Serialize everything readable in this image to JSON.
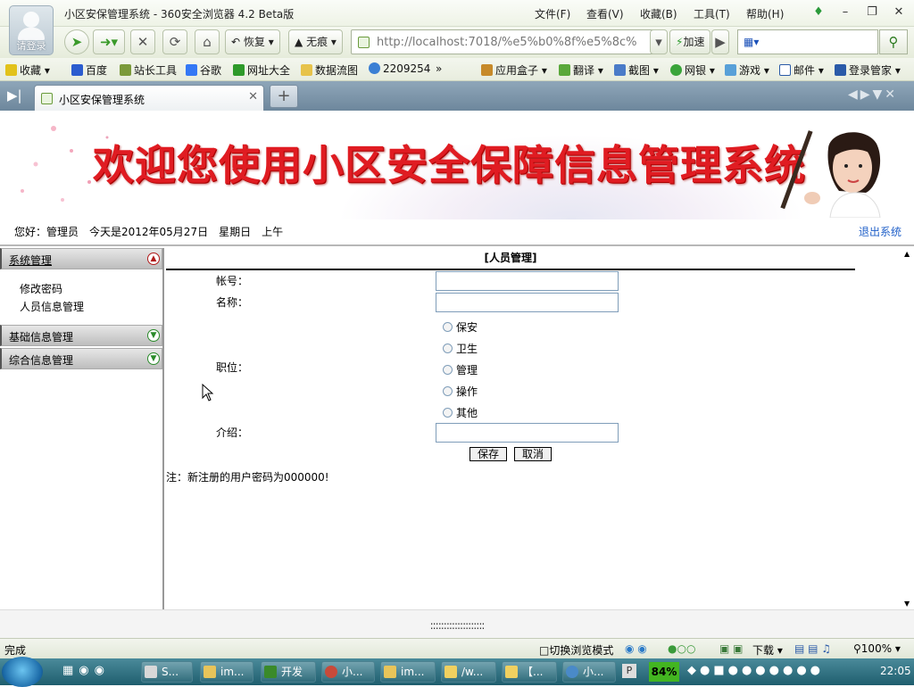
{
  "browser": {
    "avatar_label": "请登录",
    "window_title": "小区安保管理系统 - 360安全浏览器 4.2 Beta版",
    "menus": [
      "文件(F)",
      "查看(V)",
      "收藏(B)",
      "工具(T)",
      "帮助(H)"
    ],
    "restore_label": "恢复",
    "incognito_label": "无痕",
    "url": "http://localhost:7018/%e5%b0%8f%e5%8c%bl",
    "accelerate_label": "加速",
    "favorites": [
      "收藏",
      "百度",
      "站长工具",
      "谷歌",
      "网址大全",
      "数据流图",
      "2209254",
      "应用盒子",
      "翻译",
      "截图",
      "网银",
      "游戏",
      "邮件",
      "登录管家"
    ],
    "tab_title": "小区安保管理系统"
  },
  "header": {
    "banner_title": "欢迎您使用小区安全保障信息管理系统",
    "greeting": "您好：管理员　今天是2012年05月27日　星期日　上午",
    "logout": "退出系统"
  },
  "sidebar": {
    "sections": [
      {
        "label": "系统管理",
        "items": [
          "修改密码",
          "人员信息管理"
        ]
      },
      {
        "label": "基础信息管理"
      },
      {
        "label": "综合信息管理"
      }
    ]
  },
  "form": {
    "title": "[人员管理]",
    "account_label": "帐号：",
    "account_value": "",
    "name_label": "名称：",
    "name_value": "",
    "position_label": "职位：",
    "positions": [
      "保安",
      "卫生",
      "管理",
      "操作",
      "其他"
    ],
    "intro_label": "介绍：",
    "intro_value": "",
    "save": "保存",
    "cancel": "取消",
    "note": "注：新注册的用户密码为000000!"
  },
  "status": {
    "text": "完成",
    "switch_mode": "切换浏览模式",
    "download": "下载",
    "zoom": "100%",
    "splitter": "::::::::::::::::::::"
  },
  "taskbar": {
    "items": [
      "S...",
      "im...",
      "开发",
      "小...",
      "im...",
      "/w...",
      "【...",
      "小..."
    ],
    "battery": "84%",
    "clock": "22:05"
  }
}
